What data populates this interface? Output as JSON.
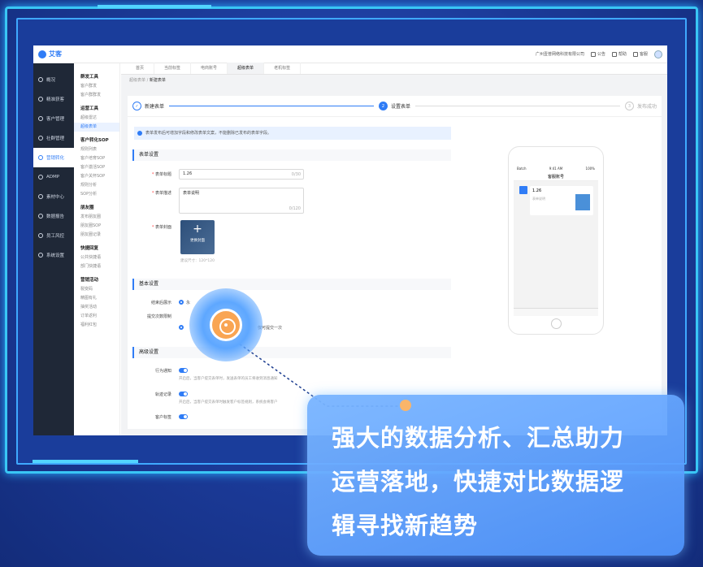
{
  "app": {
    "logo": "艾客",
    "company": "广州壹普网络科技有限公司",
    "announce": "公告",
    "help": "帮助",
    "service": "客服"
  },
  "sidebar": {
    "items": [
      {
        "label": "概况"
      },
      {
        "label": "精准获客"
      },
      {
        "label": "客户管理"
      },
      {
        "label": "社群管理"
      },
      {
        "label": "营销转化",
        "active": true
      },
      {
        "label": "ADMP"
      },
      {
        "label": "素材中心"
      },
      {
        "label": "数据报告"
      },
      {
        "label": "员工风控"
      },
      {
        "label": "系统设置"
      }
    ]
  },
  "subnav": {
    "groups": [
      {
        "title": "群发工具",
        "items": [
          "客户群发",
          "客户群群发"
        ]
      },
      {
        "title": "运营工具",
        "items": [
          "超级雷达",
          "超级表单"
        ]
      },
      {
        "title": "客户转化SOP",
        "items": [
          "规则列表",
          "客户培育SOP",
          "客户激活SOP",
          "客户关怀SOP",
          "规则分析",
          "SOP分析"
        ]
      },
      {
        "title": "朋友圈",
        "items": [
          "发布朋友圈",
          "朋友圈SOP",
          "朋友圈记录"
        ]
      },
      {
        "title": "快捷回复",
        "items": [
          "公共快捷语",
          "部门快捷语"
        ]
      },
      {
        "title": "营销活动",
        "items": [
          "裂变码",
          "精图有礼",
          "抽奖活动",
          "订单返利",
          "福利红包"
        ]
      }
    ]
  },
  "tabs": [
    "首页",
    "当前标签",
    "电商账号",
    "超级表单",
    "老机标签"
  ],
  "breadcrumb": {
    "parent": "超级表单",
    "current": "新建表单"
  },
  "steps": [
    {
      "label": "新建表单",
      "num": "✓"
    },
    {
      "label": "设置表单",
      "num": "2"
    },
    {
      "label": "发布成功",
      "num": "3"
    }
  ],
  "notice": "表单发布后可增加字段和修改表单文案，不能删除已发布的表单字段。",
  "form": {
    "section1": "表单设置",
    "title_label": "表单标题",
    "title_value": "1.26",
    "title_count": "0/30",
    "desc_label": "表单描述",
    "desc_value": "表单说明",
    "desc_count": "0/120",
    "cover_label": "表单封面",
    "cover_text": "更换封面",
    "cover_hint": "建议尺寸：120*120",
    "section2": "基本设置",
    "end_label": "结束后展示",
    "end_option": "永",
    "submit_label": "提交次数限制",
    "submit_option2": "仅可提交一次",
    "section3": "高级设置",
    "behavior_label": "行为通知",
    "behavior_desc": "开启后，当客户提交表单时，发送表单的员工将收到消息通知",
    "track_label": "轨迹记录",
    "track_desc": "开启后，当客户提交表单时触发客户标签规则，系统会将客户",
    "tag_label": "客户标签"
  },
  "phone": {
    "status_left": "Batch",
    "status_mid": "9:41 AM",
    "status_right": "100%",
    "title": "客服账号",
    "msg_title": "1.26",
    "msg_sub": "表单说明"
  },
  "callout": {
    "line1": "强大的数据分析、汇总助力",
    "line2": "运营落地，快捷对比数据逻",
    "line3": "辑寻找新趋势"
  }
}
